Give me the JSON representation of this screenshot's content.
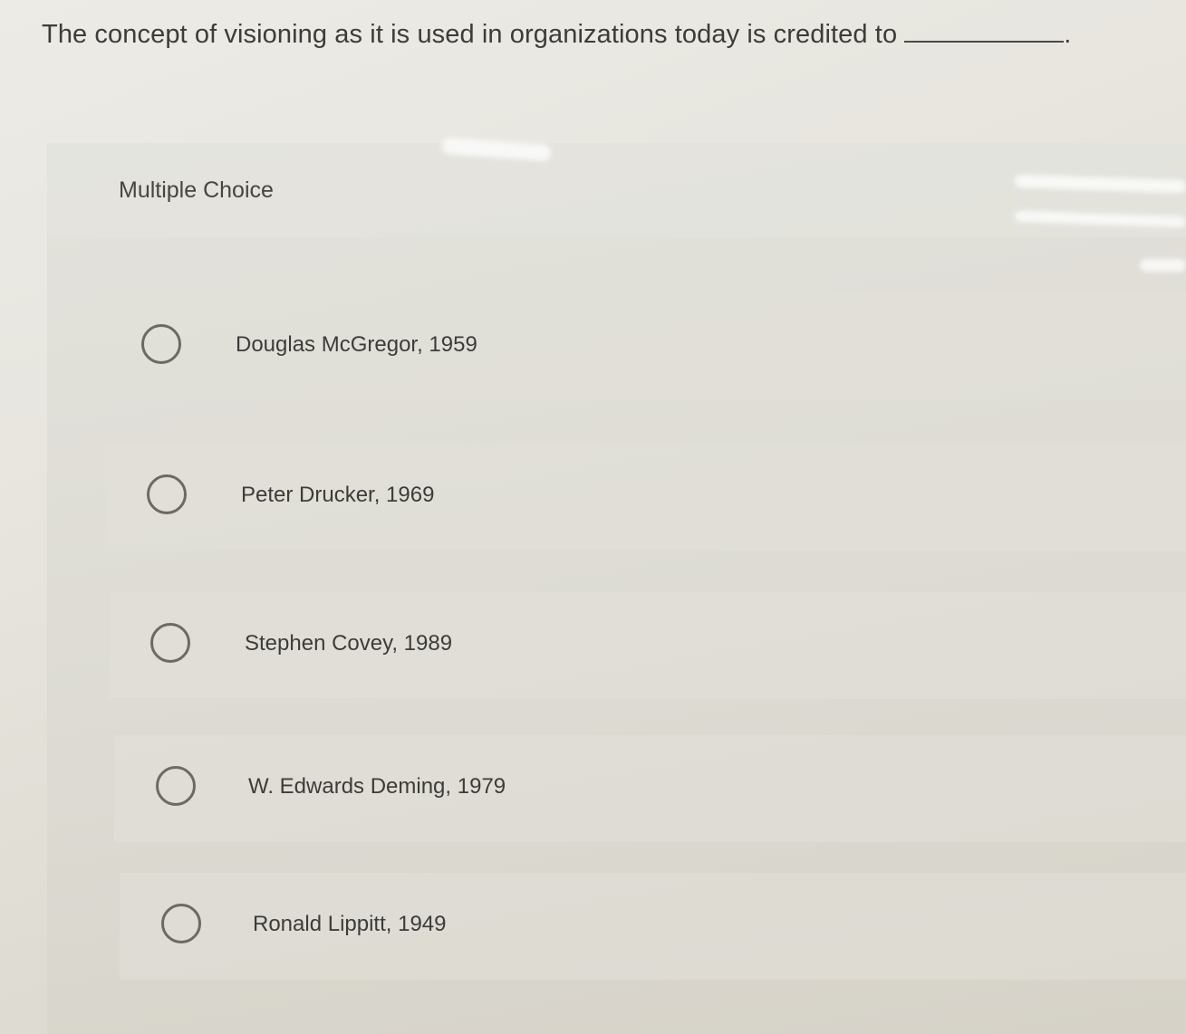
{
  "question": {
    "text": "The concept of visioning as it is used in organizations today is credited to",
    "end_punct": "."
  },
  "section": {
    "title": "Multiple Choice"
  },
  "options": [
    {
      "label": "Douglas McGregor, 1959"
    },
    {
      "label": "Peter Drucker, 1969"
    },
    {
      "label": "Stephen Covey, 1989"
    },
    {
      "label": "W. Edwards Deming, 1979"
    },
    {
      "label": "Ronald Lippitt, 1949"
    }
  ]
}
